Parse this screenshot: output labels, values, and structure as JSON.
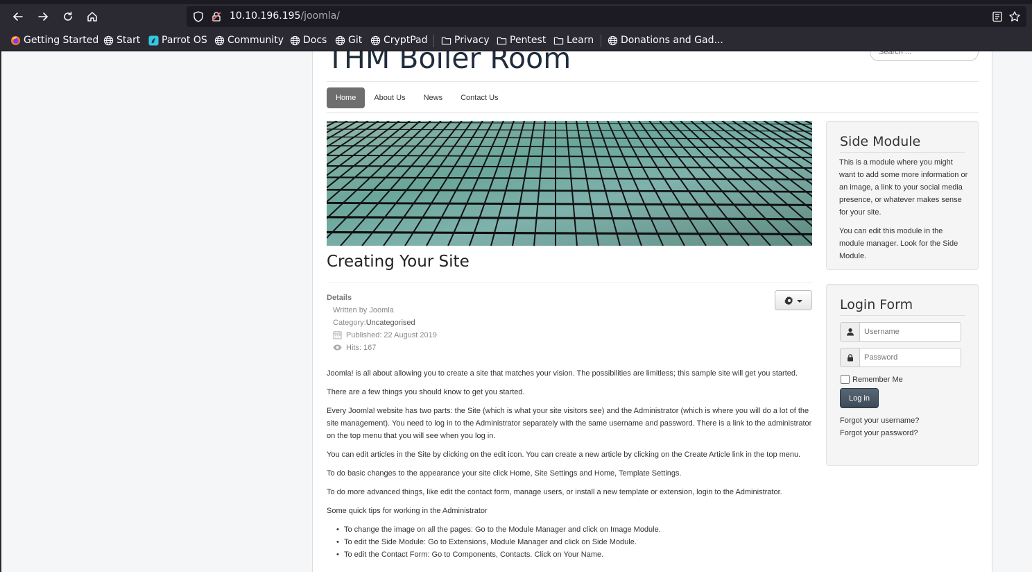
{
  "browser": {
    "url_host": "10.10.196.195",
    "url_path": "/joomla/",
    "bookmarks": [
      {
        "label": "Getting Started",
        "icon": "firefox-icon"
      },
      {
        "label": "Start",
        "icon": "globe-icon"
      },
      {
        "label": "Parrot OS",
        "icon": "parrot-icon"
      },
      {
        "label": "Community",
        "icon": "globe-icon"
      },
      {
        "label": "Docs",
        "icon": "globe-icon"
      },
      {
        "label": "Git",
        "icon": "globe-icon"
      },
      {
        "label": "CryptPad",
        "icon": "globe-icon"
      },
      {
        "label": "Privacy",
        "icon": "folder-icon"
      },
      {
        "label": "Pentest",
        "icon": "folder-icon"
      },
      {
        "label": "Learn",
        "icon": "folder-icon"
      },
      {
        "label": "Donations and Gad...",
        "icon": "globe-icon"
      }
    ]
  },
  "site": {
    "brand": "THM Boiler Room",
    "search_placeholder": "Search ...",
    "menu": [
      {
        "label": "Home",
        "active": true
      },
      {
        "label": "About Us",
        "active": false
      },
      {
        "label": "News",
        "active": false
      },
      {
        "label": "Contact Us",
        "active": false
      }
    ]
  },
  "article": {
    "title": "Creating Your Site",
    "details_heading": "Details",
    "written_by": "Written by Joomla",
    "category_label": "Category: ",
    "category_value": "Uncategorised",
    "published": "Published: 22 August 2019",
    "hits": "Hits: 167",
    "paragraphs": [
      "Joomla! is all about allowing you to create a site that matches your vision. The possibilities are limitless; this sample site will get you started.",
      "There are a few things you should know to get you started.",
      "Every Joomla! website has two parts: the Site (which is what your site visitors see) and the Administrator (which is where you will do a lot of the site management). You need to log in to the Administrator separately with the same username and password. There is a link to the administrator on the top menu that you will see when you log in.",
      "You can edit articles in the Site by clicking on the edit icon. You can create a new article by clicking on the Create Article link in the top menu.",
      "To do basic changes to the appearance your site click Home, Site Settings and Home, Template Settings.",
      "To do more advanced things, like edit the contact form, manage users, or install a new template or extension, login to the Administrator.",
      "Some quick tips for working in the Administrator"
    ],
    "tips": [
      "To change the image on all the pages: Go to the Module Manager and click on Image Module.",
      "To edit the Side Module: Go to Extensions, Module Manager and click on Side Module.",
      "To edit the Contact Form: Go to Components, Contacts. Click on Your Name."
    ]
  },
  "side_module": {
    "title": "Side Module",
    "p1": "This is a module where you might want to add some more information or an image, a link to your social media presence, or whatever makes sense for your site.",
    "p2": "You can edit this module in the module manager. Look for the Side Module."
  },
  "login": {
    "title": "Login Form",
    "username_placeholder": "Username",
    "password_placeholder": "Password",
    "remember_label": "Remember Me",
    "button_label": "Log in",
    "forgot_username": "Forgot your username?",
    "forgot_password": "Forgot your password?"
  },
  "colors": {
    "browser_chrome": "#2b2a33",
    "urlbar": "#1c1b22",
    "active_menu": "#6e6e6e",
    "login_button": "#3d4a58"
  }
}
